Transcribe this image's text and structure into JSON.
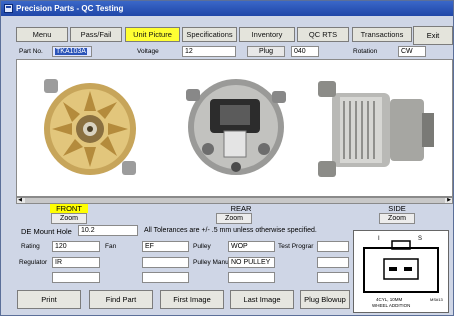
{
  "window": {
    "title": "Precision Parts - QC Testing"
  },
  "tabs": [
    {
      "label": "Menu"
    },
    {
      "label": "Pass/Fail"
    },
    {
      "label": "Unit Picture",
      "active": true
    },
    {
      "label": "Specifications"
    },
    {
      "label": "Inventory"
    },
    {
      "label": "QC RTS"
    },
    {
      "label": "Transactions"
    }
  ],
  "exit_label": "Exit",
  "header": {
    "part_no_label": "Part No.",
    "part_no_value": "TKA103A",
    "voltage_label": "Voltage",
    "voltage_value": "12",
    "plug_label": "Plug",
    "plug_value": "040",
    "rotation_label": "Rotation",
    "rotation_value": "CW"
  },
  "views": {
    "front": "FRONT",
    "rear": "REAR",
    "side": "SIDE",
    "zoom": "Zoom"
  },
  "mount": {
    "label": "DE Mount Hole",
    "value": "10.2",
    "tolerance_note": "All Tolerances are +/- .5 mm unless otherwise specified."
  },
  "specs": {
    "rating_label": "Rating",
    "rating_value": "120",
    "fan_label": "Fan",
    "fan_value": "EF",
    "pulley_label": "Pulley",
    "pulley_value": "WOP",
    "test_program_label": "Test Prograr",
    "regulator_label": "Regulator",
    "regulator_value": "IR",
    "pulley_manuf_label": "Pulley Manuf",
    "pulley_manuf_value": "NO PULLEY"
  },
  "buttons": {
    "print": "Print",
    "find_part": "Find Part",
    "first_image": "First Image",
    "last_image": "Last Image",
    "plug_blowup": "Plug Blowup"
  },
  "plug_diagram": {
    "pin_left": "I",
    "pin_right": "S",
    "caption_line1": "4CYL, 10MM",
    "caption_line2": "WHEEL ADDITION",
    "code": "MS#13"
  },
  "colors": {
    "active_tab": "#ffff33",
    "front_caption": "#ffff00",
    "title_bar": "#2a55b8",
    "window_bg": "#cfd6e6"
  }
}
